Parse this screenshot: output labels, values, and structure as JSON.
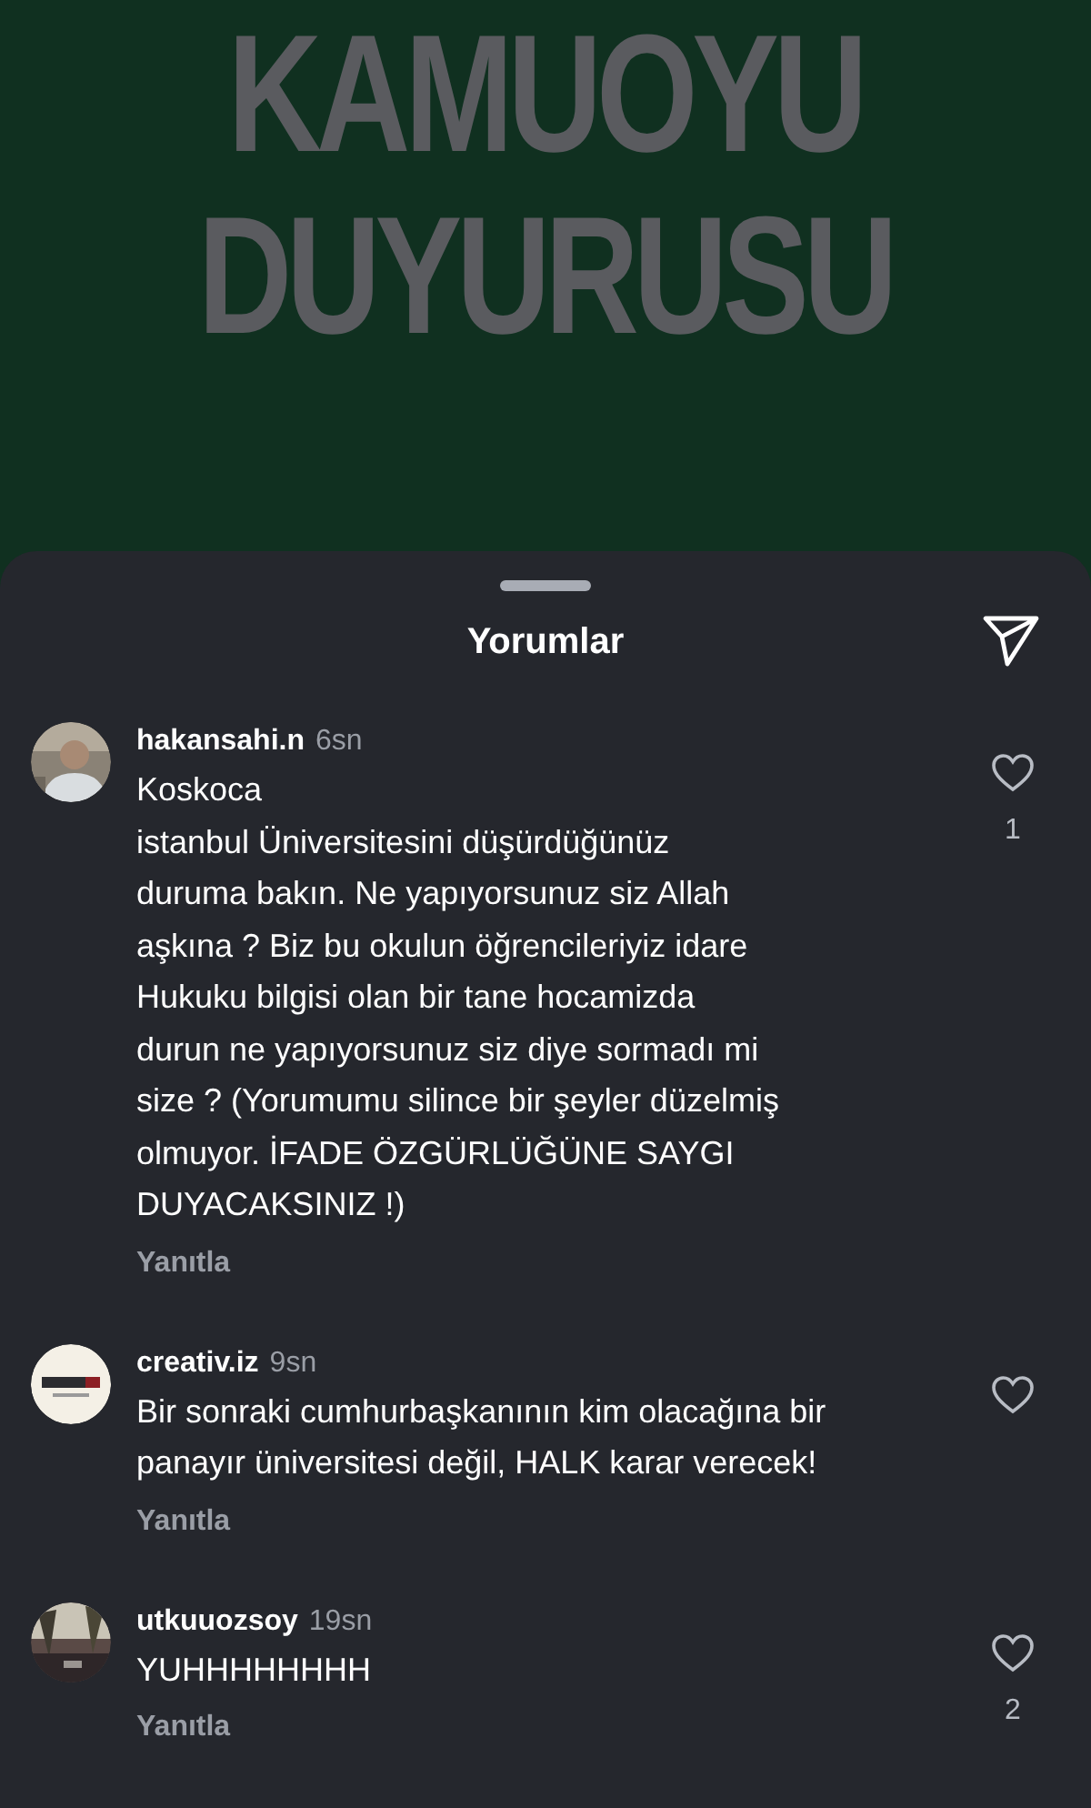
{
  "post": {
    "headline": [
      "KAMUOYU",
      "DUYURUSU"
    ]
  },
  "sheet": {
    "title": "Yorumlar"
  },
  "comments": [
    {
      "username": "hakansahi.n",
      "time": "6sn",
      "text": "Koskoca\nistanbul Üniversitesini düşürdüğünüz\nduruma bakın. Ne yapıyorsunuz siz Allah\naşkına ? Biz bu okulun öğrencileriyiz idare\nHukuku bilgisi olan bir tane hocamizda\ndurun ne yapıyorsunuz siz diye sormadı mi\nsize ? (Yorumumu silince bir şeyler düzelmiş\nolmuyor. İFADE ÖZGÜRLÜĞÜNE SAYGI\nDUYACAKSINIZ !)",
      "reply": "Yanıtla",
      "liked": false,
      "likes": "1"
    },
    {
      "username": "creativ.iz",
      "time": "9sn",
      "text": "Bir sonraki cumhurbaşkanının kim olacağına bir\npanayır üniversitesi değil, HALK karar verecek!",
      "reply": "Yanıtla",
      "liked": false
    },
    {
      "username": "utkuuozsoy",
      "time": "19sn",
      "text": "YUHHHHHHHH",
      "reply": "Yanıtla",
      "liked": false,
      "likes": "2"
    }
  ]
}
